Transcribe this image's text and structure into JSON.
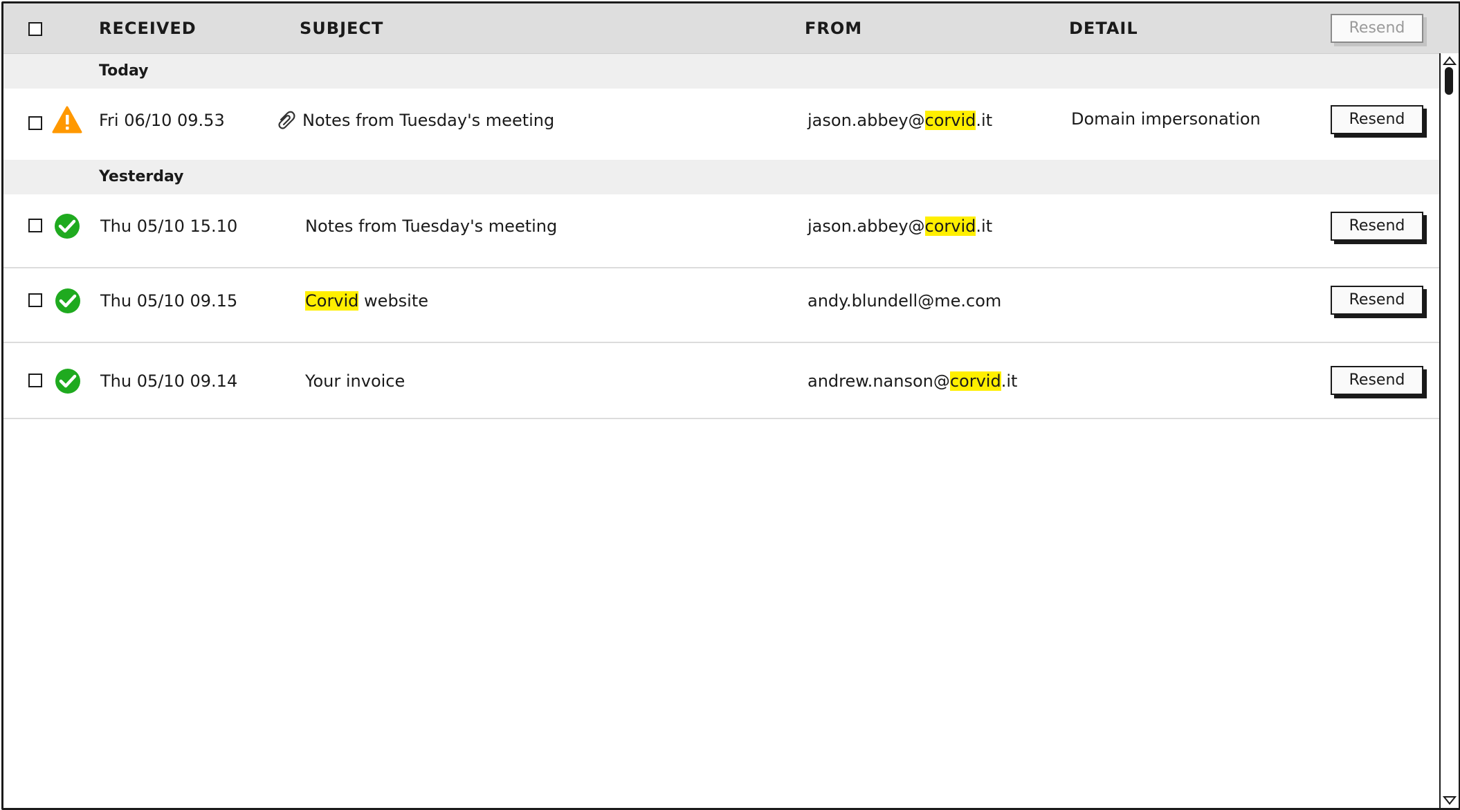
{
  "header": {
    "received": "RECEIVED",
    "subject": "SUBJECT",
    "from": "FROM",
    "detail": "DETAIL",
    "resend_label": "Resend"
  },
  "groups": [
    {
      "label": "Today"
    },
    {
      "label": "Yesterday"
    }
  ],
  "rows": [
    {
      "status_icon": "warning-icon",
      "received": "Fri 06/10 09.53",
      "has_attachment": true,
      "subject_pre": "",
      "subject_hl": "",
      "subject_post": "Notes from Tuesday's meeting",
      "from_pre": "jason.abbey@",
      "from_hl": "corvid",
      "from_post": ".it",
      "detail": "Domain impersonation",
      "resend_label": "Resend"
    },
    {
      "status_icon": "check-circle-icon",
      "received": "Thu 05/10 15.10",
      "has_attachment": false,
      "subject_pre": "",
      "subject_hl": "",
      "subject_post": "Notes from Tuesday's meeting",
      "from_pre": "jason.abbey@",
      "from_hl": "corvid",
      "from_post": ".it",
      "detail": "",
      "resend_label": "Resend"
    },
    {
      "status_icon": "check-circle-icon",
      "received": "Thu 05/10 09.15",
      "has_attachment": false,
      "subject_pre": "",
      "subject_hl": "Corvid",
      "subject_post": " website",
      "from_pre": "andy.blundell@me.com",
      "from_hl": "",
      "from_post": "",
      "detail": "",
      "resend_label": "Resend"
    },
    {
      "status_icon": "check-circle-icon",
      "received": "Thu 05/10 09.14",
      "has_attachment": false,
      "subject_pre": "",
      "subject_hl": "",
      "subject_post": "Your invoice",
      "from_pre": "andrew.nanson@",
      "from_hl": "corvid",
      "from_post": ".it",
      "detail": "",
      "resend_label": "Resend"
    }
  ],
  "colors": {
    "highlight": "#ffef00",
    "warning": "#ff9800",
    "success": "#1faa1f",
    "header_bg": "#dedede",
    "group_bg": "#efefef"
  }
}
